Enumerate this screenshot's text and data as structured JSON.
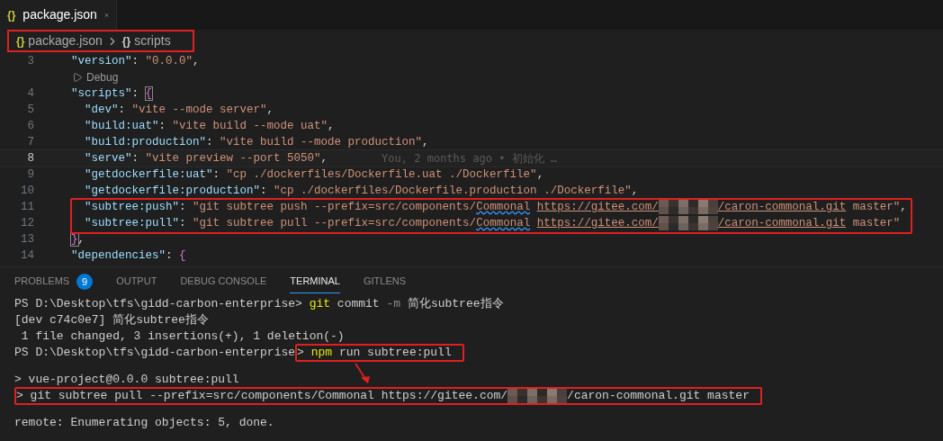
{
  "editor_tab": {
    "icon": "{}",
    "label": "package.json"
  },
  "breadcrumb": {
    "boxed": true,
    "items": [
      {
        "icon": "{}",
        "kind": "file",
        "label": "package.json"
      },
      {
        "icon": "{}",
        "kind": "object",
        "label": "scripts"
      }
    ]
  },
  "code_lines": [
    {
      "kind": "code",
      "number": "3",
      "current": false,
      "boxed": false,
      "segments": [
        {
          "kind": "key",
          "text": "  \"version\""
        },
        {
          "kind": "punct",
          "text": ": "
        },
        {
          "kind": "string",
          "text": "\"0.0.0\""
        },
        {
          "kind": "punct",
          "text": ","
        }
      ]
    },
    {
      "kind": "codelens",
      "label": "Debug",
      "boxed": false
    },
    {
      "kind": "code",
      "number": "4",
      "current": false,
      "boxed": false,
      "segments": [
        {
          "kind": "key",
          "text": "  \"scripts\""
        },
        {
          "kind": "punct",
          "text": ": "
        },
        {
          "kind": "bracket",
          "text": "{",
          "matched": true
        }
      ]
    },
    {
      "kind": "code",
      "number": "5",
      "current": false,
      "boxed": false,
      "segments": [
        {
          "kind": "key",
          "text": "    \"dev\""
        },
        {
          "kind": "punct",
          "text": ": "
        },
        {
          "kind": "string",
          "text": "\"vite --mode server\""
        },
        {
          "kind": "punct",
          "text": ","
        }
      ]
    },
    {
      "kind": "code",
      "number": "6",
      "current": false,
      "boxed": false,
      "segments": [
        {
          "kind": "key",
          "text": "    \"build:uat\""
        },
        {
          "kind": "punct",
          "text": ": "
        },
        {
          "kind": "string",
          "text": "\"vite build --mode uat\""
        },
        {
          "kind": "punct",
          "text": ","
        }
      ]
    },
    {
      "kind": "code",
      "number": "7",
      "current": false,
      "boxed": false,
      "segments": [
        {
          "kind": "key",
          "text": "    \"build:production\""
        },
        {
          "kind": "punct",
          "text": ": "
        },
        {
          "kind": "string",
          "text": "\"vite build --mode production\""
        },
        {
          "kind": "punct",
          "text": ","
        }
      ]
    },
    {
      "kind": "code",
      "number": "8",
      "current": true,
      "boxed": false,
      "segments": [
        {
          "kind": "key",
          "text": "    \"serve\""
        },
        {
          "kind": "punct",
          "text": ": "
        },
        {
          "kind": "string",
          "text": "\"vite preview --port 5050\""
        },
        {
          "kind": "punct",
          "text": ","
        },
        {
          "kind": "blame",
          "text": "You, 2 months ago • 初始化 …"
        }
      ]
    },
    {
      "kind": "code",
      "number": "9",
      "current": false,
      "boxed": false,
      "segments": [
        {
          "kind": "key",
          "text": "    \"getdockerfile:uat\""
        },
        {
          "kind": "punct",
          "text": ": "
        },
        {
          "kind": "string",
          "text": "\"cp ./dockerfiles/Dockerfile.uat ./Dockerfile\""
        },
        {
          "kind": "punct",
          "text": ","
        }
      ]
    },
    {
      "kind": "code",
      "number": "10",
      "current": false,
      "boxed": false,
      "segments": [
        {
          "kind": "key",
          "text": "    \"getdockerfile:production\""
        },
        {
          "kind": "punct",
          "text": ": "
        },
        {
          "kind": "string",
          "text": "\"cp ./dockerfiles/Dockerfile.production ./Dockerfile\""
        },
        {
          "kind": "punct",
          "text": ","
        }
      ]
    },
    {
      "kind": "code",
      "number": "11",
      "current": false,
      "boxed": true,
      "segments": [
        {
          "kind": "key",
          "text": "    \"subtree:push\""
        },
        {
          "kind": "punct",
          "text": ": "
        },
        {
          "kind": "string",
          "text": "\"git subtree push --prefix=src/components/"
        },
        {
          "kind": "squiggle",
          "text": "Commonal"
        },
        {
          "kind": "link",
          "text": " https://gitee.com/"
        },
        {
          "kind": "redacted"
        },
        {
          "kind": "link",
          "text": "/caron-commonal.git"
        },
        {
          "kind": "string",
          "text": " master\""
        },
        {
          "kind": "punct",
          "text": ","
        }
      ]
    },
    {
      "kind": "code",
      "number": "12",
      "current": false,
      "boxed": true,
      "segments": [
        {
          "kind": "key",
          "text": "    \"subtree:pull\""
        },
        {
          "kind": "punct",
          "text": ": "
        },
        {
          "kind": "string",
          "text": "\"git subtree pull --prefix=src/components/"
        },
        {
          "kind": "squiggle",
          "text": "Commonal"
        },
        {
          "kind": "link",
          "text": " https://gitee.com/"
        },
        {
          "kind": "redacted"
        },
        {
          "kind": "link",
          "text": "/caron-commonal.git"
        },
        {
          "kind": "string",
          "text": " master\""
        }
      ]
    },
    {
      "kind": "code",
      "number": "13",
      "current": false,
      "boxed": false,
      "segments": [
        {
          "kind": "bracket",
          "text": "  }",
          "matched": true
        },
        {
          "kind": "punct",
          "text": ","
        }
      ]
    },
    {
      "kind": "code",
      "number": "14",
      "current": false,
      "boxed": false,
      "segments": [
        {
          "kind": "key",
          "text": "  \"dependencies\""
        },
        {
          "kind": "punct",
          "text": ": "
        },
        {
          "kind": "bracket",
          "text": "{",
          "matched": false
        }
      ]
    }
  ],
  "panel_tabs": [
    {
      "label": "PROBLEMS",
      "badge": "9",
      "selected": false
    },
    {
      "label": "OUTPUT",
      "selected": false
    },
    {
      "label": "DEBUG CONSOLE",
      "selected": false
    },
    {
      "label": "TERMINAL",
      "selected": true
    },
    {
      "label": "GITLENS",
      "selected": false
    }
  ],
  "terminal_lines": [
    {
      "kind": "output",
      "segments": [
        {
          "kind": "prompt",
          "text": "PS D:\\Desktop\\tfs\\gidd-carbon-enterprise> ",
          "boxed": false
        },
        {
          "kind": "command",
          "text": "git",
          "boxed": false
        },
        {
          "kind": "text",
          "text": " commit ",
          "boxed": false
        },
        {
          "kind": "flag",
          "text": "-m",
          "boxed": false
        },
        {
          "kind": "text",
          "text": " 简化subtree指令",
          "boxed": false
        }
      ]
    },
    {
      "kind": "output",
      "segments": [
        {
          "kind": "text",
          "text": "[dev c74c0e7] 简化subtree指令",
          "boxed": false
        }
      ]
    },
    {
      "kind": "output",
      "segments": [
        {
          "kind": "text",
          "text": " 1 file changed, 3 insertions(+), 1 deletion(-)",
          "boxed": false
        }
      ]
    },
    {
      "kind": "output",
      "segments": [
        {
          "kind": "prompt",
          "text": "PS D:\\Desktop\\tfs\\gidd-carbon-enterprise",
          "boxed": false
        },
        {
          "kind": "prompt",
          "text": "> ",
          "boxed": true
        },
        {
          "kind": "command",
          "text": "npm",
          "boxed": true
        },
        {
          "kind": "text",
          "text": " run subtree:pull",
          "boxed": true
        }
      ]
    },
    {
      "kind": "blank"
    },
    {
      "kind": "output",
      "segments": [
        {
          "kind": "text",
          "text": "> vue-project@0.0.0 subtree:pull",
          "boxed": false
        }
      ]
    },
    {
      "kind": "output",
      "segments": [
        {
          "kind": "text",
          "text": "> git subtree pull --prefix=src/components/Commonal https://gitee.com/",
          "boxed": true
        },
        {
          "kind": "redacted",
          "boxed": true
        },
        {
          "kind": "text",
          "text": "/caron-commonal.git master",
          "boxed": true
        }
      ]
    },
    {
      "kind": "blank"
    },
    {
      "kind": "output",
      "segments": [
        {
          "kind": "text",
          "text": "remote: Enumerating objects: 5, done.",
          "boxed": false
        }
      ]
    }
  ],
  "annotation_arrow": {
    "shown": true
  }
}
